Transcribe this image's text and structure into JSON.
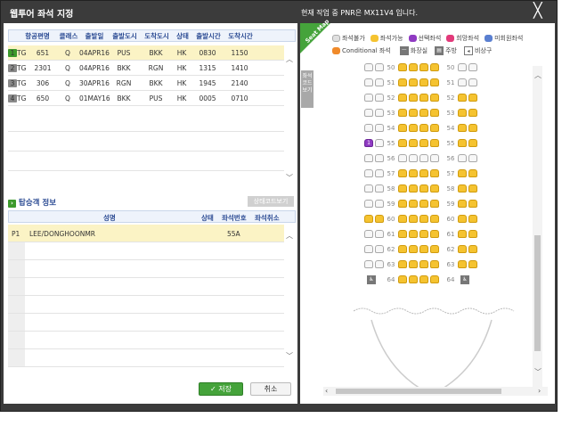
{
  "window": {
    "title": "웹투어 좌석 지정",
    "pnr_notice": "현재 작업 중 PNR은 MX11V4 입니다.",
    "close_glyph": "╳"
  },
  "flights": {
    "headers": [
      "항공편명",
      "클래스",
      "출발일",
      "출발도시",
      "도착도시",
      "상태",
      "출발시간",
      "도착시간"
    ],
    "rows": [
      {
        "no": "1",
        "airline": "TG",
        "flight": "651",
        "class": "Q",
        "date": "04APR16",
        "from": "PUS",
        "to": "BKK",
        "status": "HK",
        "dep": "0830",
        "arr": "1150",
        "selected": true
      },
      {
        "no": "2",
        "airline": "TG",
        "flight": "2301",
        "class": "Q",
        "date": "04APR16",
        "from": "BKK",
        "to": "RGN",
        "status": "HK",
        "dep": "1315",
        "arr": "1410",
        "selected": false
      },
      {
        "no": "3",
        "airline": "TG",
        "flight": "306",
        "class": "Q",
        "date": "30APR16",
        "from": "RGN",
        "to": "BKK",
        "status": "HK",
        "dep": "1945",
        "arr": "2140",
        "selected": false
      },
      {
        "no": "4",
        "airline": "TG",
        "flight": "650",
        "class": "Q",
        "date": "01MAY16",
        "from": "BKK",
        "to": "PUS",
        "status": "HK",
        "dep": "0005",
        "arr": "0710",
        "selected": false
      }
    ]
  },
  "passengers": {
    "section_title": "탑승객 정보",
    "code_button": "상태코드보기",
    "headers": {
      "name": "성명",
      "status": "상태",
      "seat": "좌석번호",
      "cancel": "좌석취소"
    },
    "rows": [
      {
        "id": "P1",
        "name": "LEE/DONGHOONMR",
        "seat": "55A"
      }
    ]
  },
  "buttons": {
    "save": "✓ 저장",
    "cancel": "취소"
  },
  "legend": {
    "items": [
      {
        "label": "좌석불가",
        "color": "#e0e0e0"
      },
      {
        "label": "좌석가능",
        "color": "#f5c330"
      },
      {
        "label": "선택좌석",
        "color": "#8f3ac2"
      },
      {
        "label": "희망좌석",
        "color": "#e23a7a"
      },
      {
        "label": "미회원좌석",
        "color": "#5a7fd0"
      }
    ],
    "conditional": {
      "label": "Conditional 좌석",
      "color": "#f08a2a"
    },
    "toilet": {
      "label": "화장실",
      "icon": "toilet-icon"
    },
    "galley": {
      "label": "주방",
      "icon": "galley-icon"
    },
    "exit": {
      "label": "비상구",
      "icon": "exit-icon"
    },
    "corner_tag": "Seat Map",
    "side_tab": "좌석코드보기"
  },
  "seatmap": {
    "rows": [
      {
        "num": "50",
        "l": "ww",
        "m": "yyyy",
        "r": "ww"
      },
      {
        "num": "51",
        "l": "ww",
        "m": "yyyy",
        "r": "ww"
      },
      {
        "num": "52",
        "l": "ww",
        "m": "yyyy",
        "r": "yy"
      },
      {
        "num": "53",
        "l": "ww",
        "m": "yyyy",
        "r": "yy"
      },
      {
        "num": "54",
        "l": "ww",
        "m": "yyyy",
        "r": "yy"
      },
      {
        "num": "55",
        "l": "pw",
        "m": "yyyy",
        "r": "yy"
      },
      {
        "num": "56",
        "l": "ww",
        "m": "wwww",
        "r": "ww"
      },
      {
        "num": "57",
        "l": "ww",
        "m": "yyyy",
        "r": "yy"
      },
      {
        "num": "58",
        "l": "ww",
        "m": "yyyy",
        "r": "yy"
      },
      {
        "num": "59",
        "l": "ww",
        "m": "yyyy",
        "r": "yy"
      },
      {
        "num": "60",
        "l": "yy",
        "m": "yyyy",
        "r": "yy"
      },
      {
        "num": "61",
        "l": "ww",
        "m": "yyyy",
        "r": "yy"
      },
      {
        "num": "62",
        "l": "ww",
        "m": "yyyy",
        "r": "yy"
      },
      {
        "num": "63",
        "l": "ww",
        "m": "yyyy",
        "r": "yy"
      },
      {
        "num": "64",
        "l": "",
        "m": "yyyy",
        "r": ""
      }
    ],
    "selected_seat_label": "1"
  }
}
